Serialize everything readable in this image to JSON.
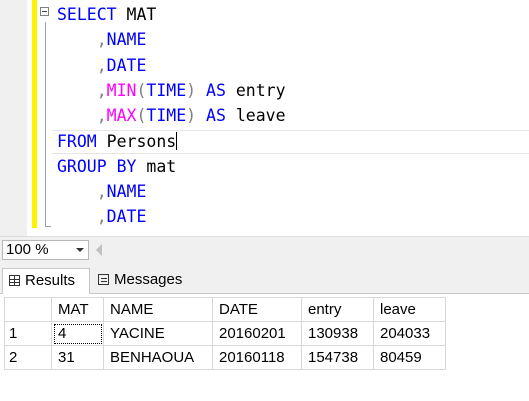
{
  "editor": {
    "lines": [
      {
        "parts": [
          {
            "t": "SELECT",
            "c": "kw"
          },
          {
            "t": " MAT",
            "c": ""
          }
        ]
      },
      {
        "parts": [
          {
            "t": "    ,",
            "c": "gray"
          },
          {
            "t": "NAME",
            "c": "kw"
          }
        ]
      },
      {
        "parts": [
          {
            "t": "    ,",
            "c": "gray"
          },
          {
            "t": "DATE",
            "c": "kw"
          }
        ]
      },
      {
        "parts": [
          {
            "t": "    ,",
            "c": "gray"
          },
          {
            "t": "MIN",
            "c": "fn"
          },
          {
            "t": "(",
            "c": "gray"
          },
          {
            "t": "TIME",
            "c": "kw"
          },
          {
            "t": ")",
            "c": "gray"
          },
          {
            "t": " AS",
            "c": "kw"
          },
          {
            "t": " entry",
            "c": ""
          }
        ]
      },
      {
        "parts": [
          {
            "t": "    ,",
            "c": "gray"
          },
          {
            "t": "MAX",
            "c": "fn"
          },
          {
            "t": "(",
            "c": "gray"
          },
          {
            "t": "TIME",
            "c": "kw"
          },
          {
            "t": ")",
            "c": "gray"
          },
          {
            "t": " AS",
            "c": "kw"
          },
          {
            "t": " leave",
            "c": ""
          }
        ]
      },
      {
        "parts": [
          {
            "t": "FROM",
            "c": "kw"
          },
          {
            "t": " Persons",
            "c": ""
          },
          {
            "t": "|",
            "c": "caret"
          }
        ]
      },
      {
        "parts": [
          {
            "t": "GROUP BY",
            "c": "kw"
          },
          {
            "t": " mat",
            "c": ""
          }
        ]
      },
      {
        "parts": [
          {
            "t": "    ,",
            "c": "gray"
          },
          {
            "t": "NAME",
            "c": "kw"
          }
        ]
      },
      {
        "parts": [
          {
            "t": "    ,",
            "c": "gray"
          },
          {
            "t": "DATE",
            "c": "kw"
          }
        ]
      }
    ]
  },
  "zoom": {
    "value": "100 %"
  },
  "tabs": {
    "results_label": "Results",
    "messages_label": "Messages"
  },
  "grid": {
    "columns": [
      "MAT",
      "NAME",
      "DATE",
      "entry",
      "leave"
    ],
    "rows": [
      {
        "num": "1",
        "cells": [
          "4",
          "YACINE",
          "20160201",
          "130938",
          "204033"
        ]
      },
      {
        "num": "2",
        "cells": [
          "31",
          "BENHAOUA",
          "20160118",
          "154738",
          "80459"
        ]
      }
    ]
  },
  "icons": [
    "grid-icon",
    "messages-icon",
    "collapse-icon",
    "dropdown-arrow-icon",
    "scroll-left-icon"
  ]
}
